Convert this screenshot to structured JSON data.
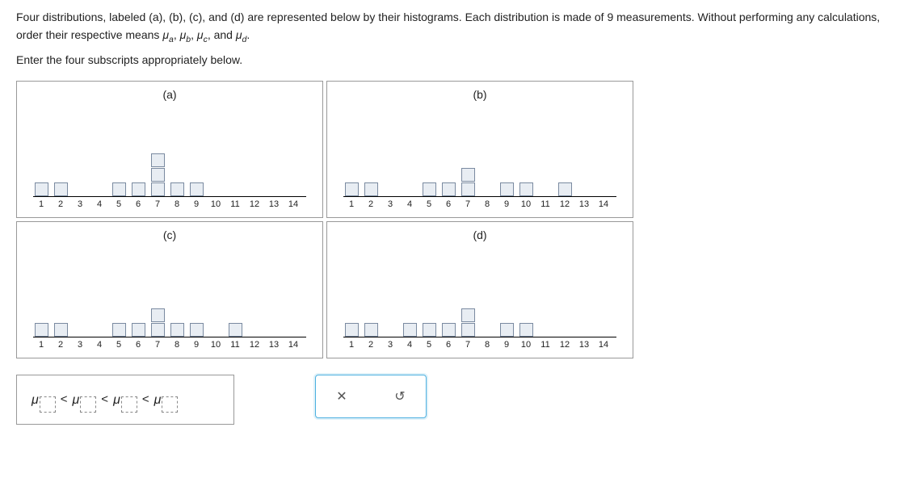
{
  "problem": {
    "line1_prefix": "Four distributions, labeled (a), (b), (c), and (d) are represented below by their histograms. Each distribution is made of ",
    "n_measurements": "9",
    "line1_suffix": " measurements. Without performing any calculations, order their respective means ",
    "mu_symbol": "μ",
    "subs": [
      "a",
      "b",
      "c",
      "d"
    ],
    "and_word": " and ",
    "period": ".",
    "enter_text": "Enter the four subscripts appropriately below."
  },
  "charts": {
    "a": {
      "title": "(a)"
    },
    "b": {
      "title": "(b)"
    },
    "c": {
      "title": "(c)"
    },
    "d": {
      "title": "(d)"
    }
  },
  "chart_data": [
    {
      "type": "bar",
      "title": "(a)",
      "categories": [
        1,
        2,
        3,
        4,
        5,
        6,
        7,
        8,
        9,
        10,
        11,
        12,
        13,
        14
      ],
      "values": [
        1,
        1,
        0,
        0,
        1,
        1,
        3,
        1,
        1,
        0,
        0,
        0,
        0,
        0
      ],
      "xlabel": "",
      "ylabel": "",
      "ylim": [
        0,
        3
      ]
    },
    {
      "type": "bar",
      "title": "(b)",
      "categories": [
        1,
        2,
        3,
        4,
        5,
        6,
        7,
        8,
        9,
        10,
        11,
        12,
        13,
        14
      ],
      "values": [
        1,
        1,
        0,
        0,
        1,
        1,
        2,
        0,
        1,
        1,
        0,
        1,
        0,
        0
      ],
      "xlabel": "",
      "ylabel": "",
      "ylim": [
        0,
        3
      ]
    },
    {
      "type": "bar",
      "title": "(c)",
      "categories": [
        1,
        2,
        3,
        4,
        5,
        6,
        7,
        8,
        9,
        10,
        11,
        12,
        13,
        14
      ],
      "values": [
        1,
        1,
        0,
        0,
        1,
        1,
        2,
        1,
        1,
        0,
        1,
        0,
        0,
        0
      ],
      "xlabel": "",
      "ylabel": "",
      "ylim": [
        0,
        3
      ]
    },
    {
      "type": "bar",
      "title": "(d)",
      "categories": [
        1,
        2,
        3,
        4,
        5,
        6,
        7,
        8,
        9,
        10,
        11,
        12,
        13,
        14
      ],
      "values": [
        1,
        1,
        0,
        1,
        1,
        1,
        2,
        0,
        1,
        1,
        0,
        0,
        0,
        0
      ],
      "xlabel": "",
      "ylabel": "",
      "ylim": [
        0,
        3
      ]
    }
  ],
  "answer": {
    "mu": "μ",
    "lt": "<"
  },
  "actions": {
    "close": "✕",
    "reset": "↺"
  }
}
